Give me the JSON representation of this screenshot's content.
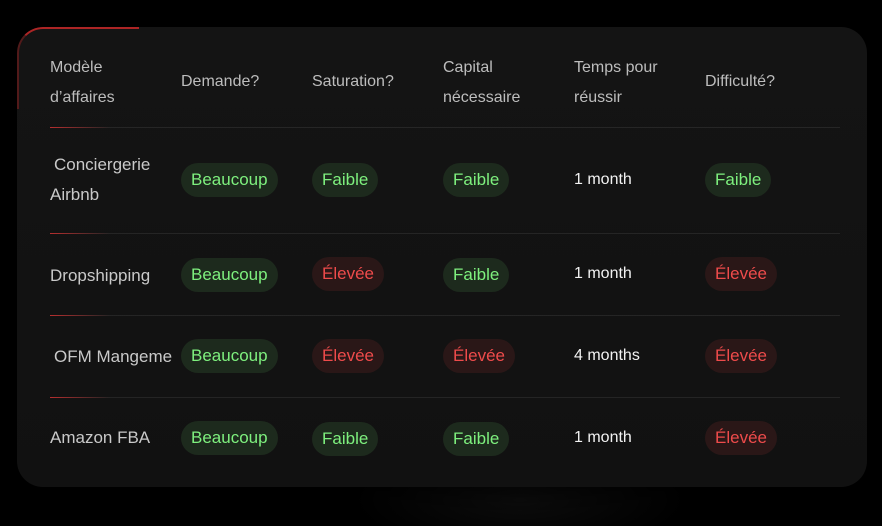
{
  "colors": {
    "good": "#7ef07e",
    "bad": "#ee4b4b"
  },
  "headers": {
    "model": [
      "Modèle",
      "d’affaires"
    ],
    "demand": "Demande?",
    "saturation": "Saturation?",
    "capital": [
      "Capital",
      "nécessaire"
    ],
    "time": [
      "Temps pour",
      "réussir"
    ],
    "difficulty": "Difficulté?"
  },
  "rows": [
    {
      "model": [
        "Conciergerie",
        "Airbnb"
      ],
      "demand": "Beaucoup",
      "saturation": "Faible",
      "capital": "Faible",
      "time": "1 month",
      "difficulty": "Faible"
    },
    {
      "model": [
        "Dropshipping"
      ],
      "demand": "Beaucoup",
      "saturation": "Élevée",
      "capital": "Faible",
      "time": "1 month",
      "difficulty": "Élevée"
    },
    {
      "model": [
        "OFM Mangeme"
      ],
      "demand": "Beaucoup",
      "saturation": "Élevée",
      "capital": "Élevée",
      "time": "4 months",
      "difficulty": "Élevée"
    },
    {
      "model": [
        "Amazon FBA"
      ],
      "demand": "Beaucoup",
      "saturation": "Faible",
      "capital": "Faible",
      "time": "1 month",
      "difficulty": "Élevée"
    }
  ]
}
